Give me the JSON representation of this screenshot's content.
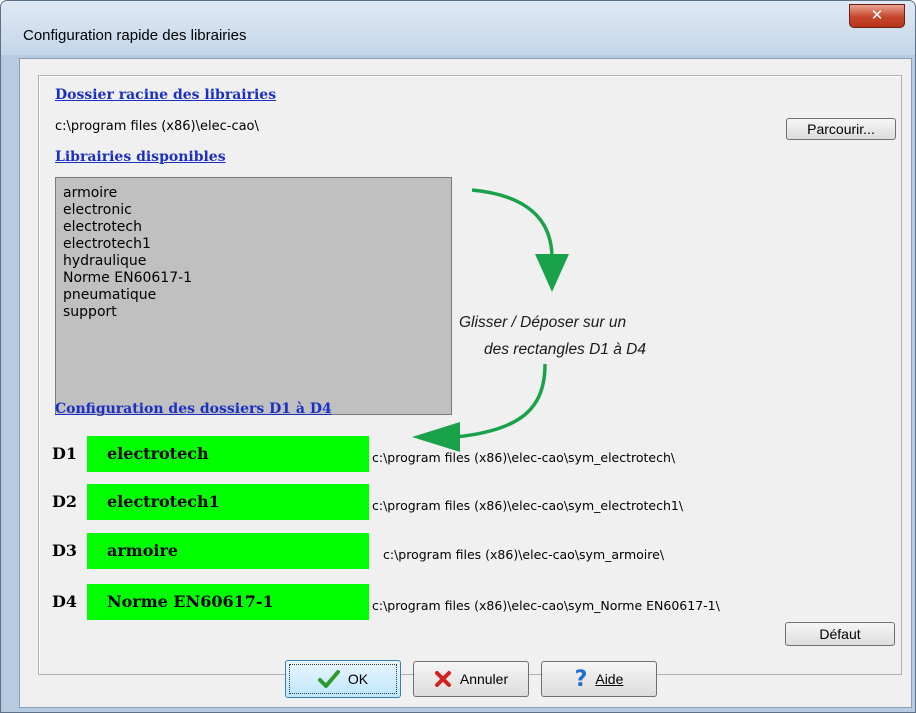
{
  "window": {
    "title": "Configuration rapide des librairies",
    "close_glyph": "✕"
  },
  "root": {
    "heading": "Dossier racine des librairies",
    "path": "c:\\program files (x86)\\elec-cao\\",
    "browse_label": "Parcourir..."
  },
  "libraries": {
    "heading": "Librairies disponibles",
    "items": [
      "armoire",
      "electronic",
      "electrotech",
      "electrotech1",
      "hydraulique",
      "Norme EN60617-1",
      "pneumatique",
      "support"
    ]
  },
  "hint": {
    "line1": "Glisser / Déposer sur un",
    "line2": "des rectangles D1 à D4"
  },
  "config": {
    "heading": "Configuration des dossiers D1 à D4",
    "rows": [
      {
        "label": "D1",
        "name": "electrotech",
        "path": "c:\\program files (x86)\\elec-cao\\sym_electrotech\\"
      },
      {
        "label": "D2",
        "name": "electrotech1",
        "path": "c:\\program files (x86)\\elec-cao\\sym_electrotech1\\"
      },
      {
        "label": "D3",
        "name": "armoire",
        "path": "c:\\program files (x86)\\elec-cao\\sym_armoire\\"
      },
      {
        "label": "D4",
        "name": "Norme EN60617-1",
        "path": "c:\\program files (x86)\\elec-cao\\sym_Norme EN60617-1\\"
      }
    ],
    "default_label": "Défaut"
  },
  "buttons": {
    "ok": "OK",
    "cancel": "Annuler",
    "help": "Aide"
  },
  "colors": {
    "slot_fill": "#00ff00",
    "arrow": "#1aa24a",
    "link": "#1a2fc4",
    "listbox": "#c0c0c0"
  },
  "icons": {
    "ok": "check-icon",
    "cancel": "cross-icon",
    "help": "question-icon",
    "close": "close-icon"
  }
}
